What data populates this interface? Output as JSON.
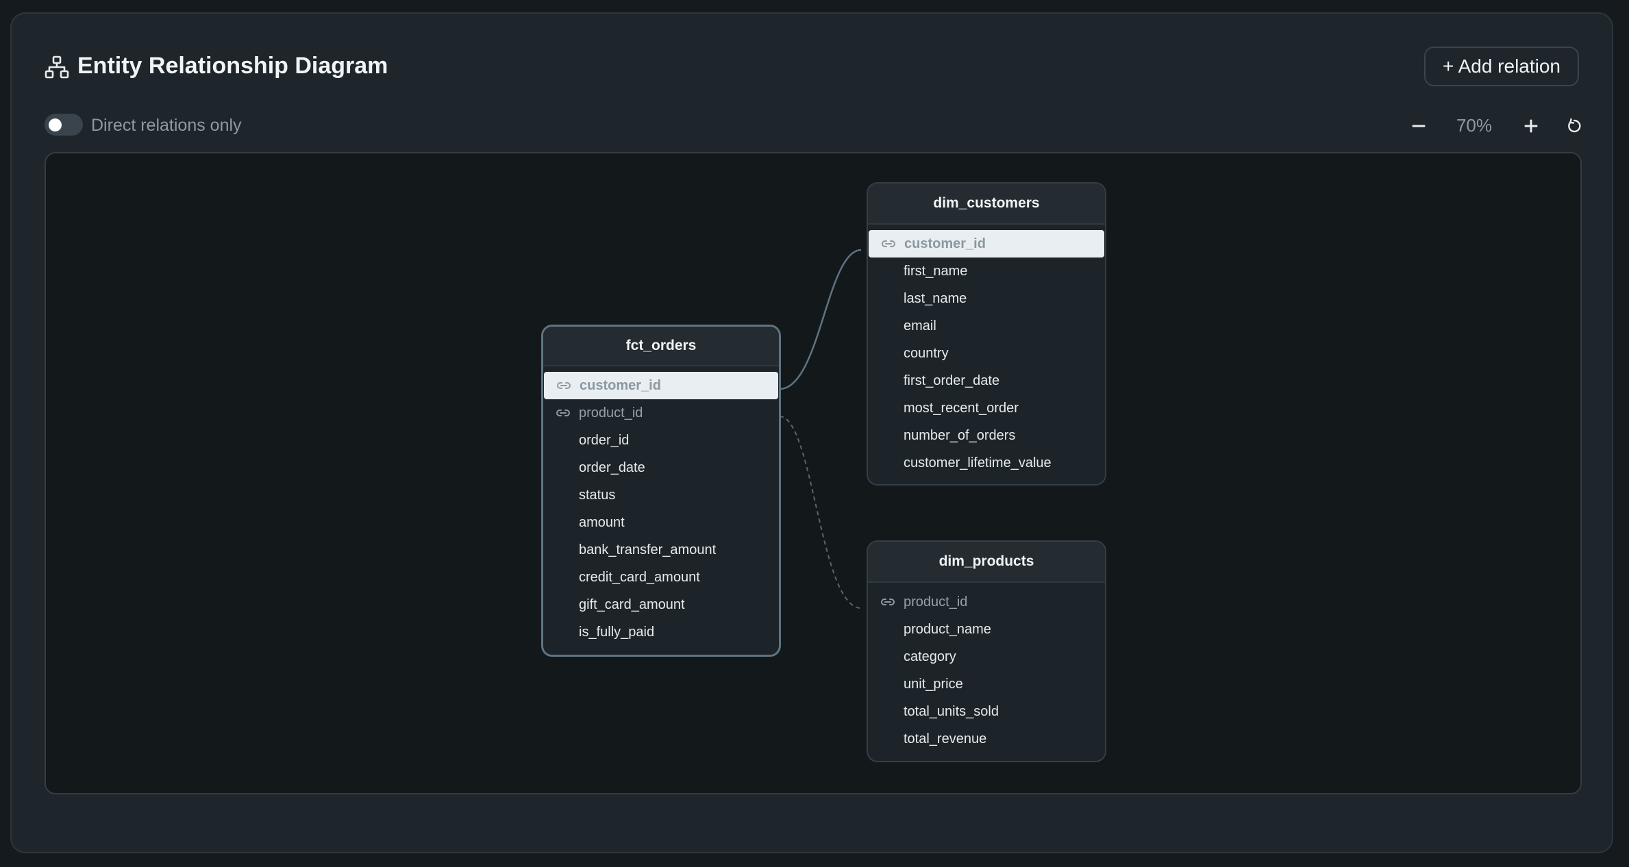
{
  "header": {
    "title": "Entity Relationship Diagram",
    "icon": "hierarchy-icon",
    "add_relation_label": "+ Add relation"
  },
  "controls": {
    "direct_only_label": "Direct relations only",
    "direct_only_enabled": false,
    "zoom_level": "70%",
    "zoom_out_icon": "minus-icon",
    "zoom_in_icon": "plus-icon",
    "reset_icon": "reset-icon"
  },
  "tables": {
    "fct_orders": {
      "name": "fct_orders",
      "selected": true,
      "columns": [
        {
          "name": "customer_id",
          "key": true,
          "highlighted": true
        },
        {
          "name": "product_id",
          "key": true,
          "highlighted": false
        },
        {
          "name": "order_id"
        },
        {
          "name": "order_date"
        },
        {
          "name": "status"
        },
        {
          "name": "amount"
        },
        {
          "name": "bank_transfer_amount"
        },
        {
          "name": "credit_card_amount"
        },
        {
          "name": "gift_card_amount"
        },
        {
          "name": "is_fully_paid"
        }
      ]
    },
    "dim_customers": {
      "name": "dim_customers",
      "columns": [
        {
          "name": "customer_id",
          "key": true,
          "highlighted": true
        },
        {
          "name": "first_name"
        },
        {
          "name": "last_name"
        },
        {
          "name": "email"
        },
        {
          "name": "country"
        },
        {
          "name": "first_order_date"
        },
        {
          "name": "most_recent_order"
        },
        {
          "name": "number_of_orders"
        },
        {
          "name": "customer_lifetime_value"
        }
      ]
    },
    "dim_products": {
      "name": "dim_products",
      "columns": [
        {
          "name": "product_id",
          "key": true
        },
        {
          "name": "product_name"
        },
        {
          "name": "category"
        },
        {
          "name": "unit_price"
        },
        {
          "name": "total_units_sold"
        },
        {
          "name": "total_revenue"
        }
      ]
    }
  },
  "relations": [
    {
      "from": "fct_orders.customer_id",
      "to": "dim_customers.customer_id",
      "style": "solid"
    },
    {
      "from": "fct_orders.product_id",
      "to": "dim_products.product_id",
      "style": "dashed"
    }
  ],
  "colors": {
    "background": "#1e252b",
    "canvas": "#13181b",
    "highlight_row": "#e8eef1",
    "edge_active": "#5d7482",
    "edge_inactive": "#5a656c"
  }
}
